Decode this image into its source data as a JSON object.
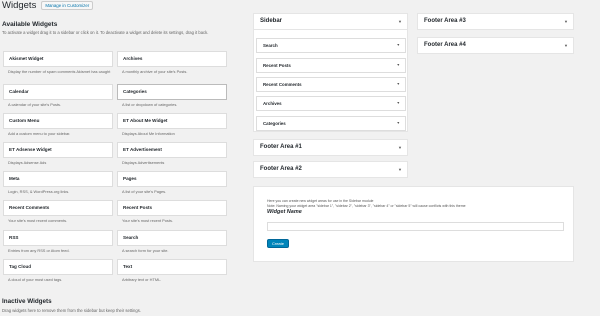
{
  "header": {
    "title": "Widgets",
    "manage_label": "Manage in Customizer"
  },
  "available": {
    "title": "Available Widgets",
    "description": "To activate a widget drag it to a sidebar or click on it. To deactivate a widget and delete its settings, drag it back."
  },
  "widgets": [
    {
      "name": "Akismet Widget",
      "desc": "Display the number of spam comments Akismet has caught"
    },
    {
      "name": "Archives",
      "desc": "A monthly archive of your site's Posts."
    },
    {
      "name": "Calendar",
      "desc": "A calendar of your site's Posts."
    },
    {
      "name": "Categories",
      "desc": "A list or dropdown of categories."
    },
    {
      "name": "Custom Menu",
      "desc": "Add a custom menu to your sidebar."
    },
    {
      "name": "ET About Me Widget",
      "desc": "Displays About Me Information"
    },
    {
      "name": "ET Adsense Widget",
      "desc": "Displays Adsense Ads"
    },
    {
      "name": "ET Advertisement",
      "desc": "Displays Advertisements"
    },
    {
      "name": "Meta",
      "desc": "Login, RSS, & WordPress.org links."
    },
    {
      "name": "Pages",
      "desc": "A list of your site's Pages."
    },
    {
      "name": "Recent Comments",
      "desc": "Your site's most recent comments."
    },
    {
      "name": "Recent Posts",
      "desc": "Your site's most recent Posts."
    },
    {
      "name": "RSS",
      "desc": "Entries from any RSS or Atom feed."
    },
    {
      "name": "Search",
      "desc": "A search form for your site."
    },
    {
      "name": "Tag Cloud",
      "desc": "A cloud of your most used tags."
    },
    {
      "name": "Text",
      "desc": "Arbitrary text or HTML."
    }
  ],
  "sidebar": {
    "title": "Sidebar",
    "items": [
      "Search",
      "Recent Posts",
      "Recent Comments",
      "Archives",
      "Categories"
    ]
  },
  "footer_areas": [
    "Footer Area #1",
    "Footer Area #2",
    "Footer Area #3",
    "Footer Area #4"
  ],
  "create_area": {
    "note1": "Here you can create new widget areas for use in the Sidebar module",
    "note2": "Note: Naming your widget area \"sidebar 1\", \"sidebar 2\", \"sidebar 3\", \"sidebar 4\" or \"sidebar 5\" will cause conflicts with this theme",
    "label": "Widget Name",
    "input_value": "",
    "button_label": "Create"
  },
  "inactive": {
    "title": "Inactive Widgets",
    "description": "Drag widgets here to remove them from the sidebar but keep their settings."
  },
  "colors": {
    "accent": "#0085ba",
    "link": "#0073aa",
    "background": "#f1f1f1"
  }
}
